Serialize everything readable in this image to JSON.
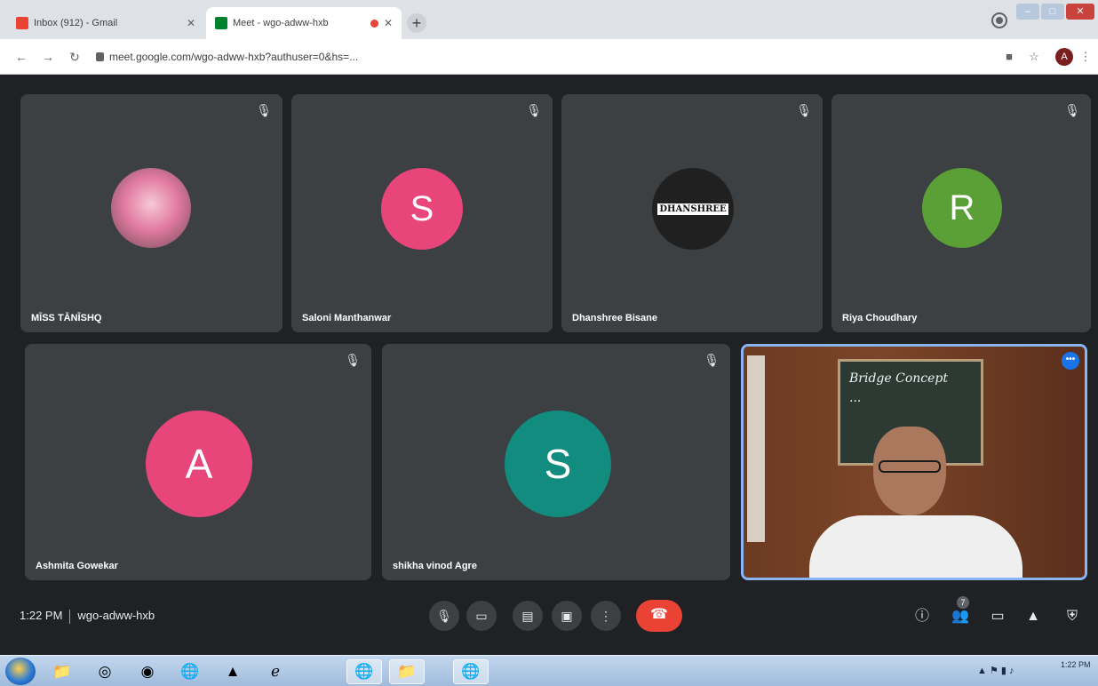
{
  "browser": {
    "tabs": [
      {
        "title": "Inbox (912) - Gmail",
        "favicon_color": "#ea4335"
      },
      {
        "title": "Meet - wgo-adww-hxb",
        "favicon_color": "#00832d",
        "recording": true
      }
    ],
    "new_tab": "+",
    "url": "meet.google.com/wgo-adww-hxb?authuser=0&hs=...",
    "account_initial": "A"
  },
  "participants": [
    {
      "name": "MĪSS TĀNĪSHQ",
      "avatar_type": "photo",
      "muted": true
    },
    {
      "name": "Saloni Manthanwar",
      "initial": "S",
      "avatar_color": "#e8457b",
      "muted": true
    },
    {
      "name": "Dhanshree Bisane",
      "avatar_type": "logo",
      "logo_text": "DHANSHREE",
      "muted": true
    },
    {
      "name": "Riya Choudhary",
      "initial": "R",
      "avatar_color": "#5aa036",
      "muted": true
    },
    {
      "name": "Ashmita Gowekar",
      "initial": "A",
      "avatar_color": "#e8457b",
      "muted": true
    },
    {
      "name": "shikha vinod Agre",
      "initial": "S",
      "avatar_color": "#128c7e",
      "muted": true
    }
  ],
  "self_view": {
    "board_lines": [
      "Bridge Concept",
      "..."
    ]
  },
  "meeting": {
    "time": "1:22 PM",
    "code": "wgo-adww-hxb",
    "participant_count": "7"
  },
  "colors": {
    "end_call": "#ea4335",
    "tile_bg": "#3c4043",
    "self_border": "#8ab4f8"
  },
  "tray": {
    "time": "1:22 PM"
  }
}
